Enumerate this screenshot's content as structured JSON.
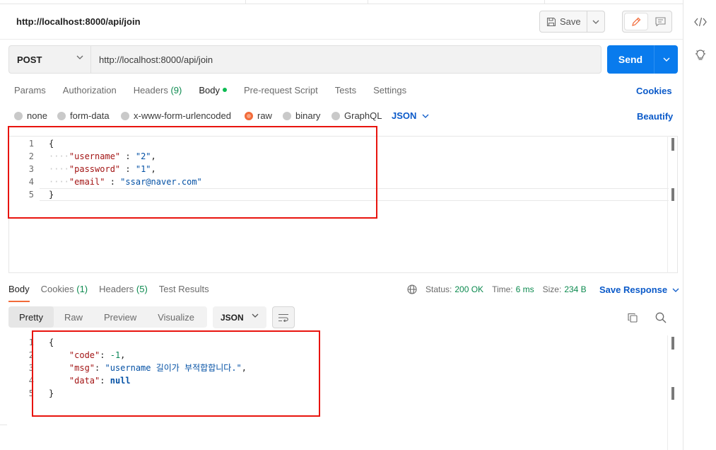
{
  "request": {
    "title": "http://localhost:8000/api/join",
    "save_label": "Save",
    "method": "POST",
    "url": "http://localhost:8000/api/join",
    "send_label": "Send",
    "tabs": [
      {
        "label": "Params"
      },
      {
        "label": "Authorization"
      },
      {
        "label": "Headers",
        "count": "(9)"
      },
      {
        "label": "Body"
      },
      {
        "label": "Pre-request Script"
      },
      {
        "label": "Tests"
      },
      {
        "label": "Settings"
      }
    ],
    "cookies_label": "Cookies",
    "body_types": [
      "none",
      "form-data",
      "x-www-form-urlencoded",
      "raw",
      "binary",
      "GraphQL"
    ],
    "selected_body_type": "raw",
    "format": "JSON",
    "beautify_label": "Beautify",
    "line_numbers": [
      "1",
      "2",
      "3",
      "4",
      "5"
    ],
    "body_lines": {
      "open": "{",
      "l2_key": "\"username\"",
      "l2_sep": " : ",
      "l2_val": "\"2\"",
      "l3_key": "\"password\"",
      "l3_sep": " : ",
      "l3_val": "\"1\"",
      "l4_key": "\"email\"",
      "l4_sep": " : ",
      "l4_val": "\"ssar@naver.com\"",
      "close": "}"
    }
  },
  "response": {
    "tabs": [
      {
        "label": "Body"
      },
      {
        "label": "Cookies",
        "count": "(1)"
      },
      {
        "label": "Headers",
        "count": "(5)"
      },
      {
        "label": "Test Results"
      }
    ],
    "status_label": "Status:",
    "status_value": "200 OK",
    "time_label": "Time:",
    "time_value": "6 ms",
    "size_label": "Size:",
    "size_value": "234 B",
    "save_response_label": "Save Response",
    "view_tabs": [
      "Pretty",
      "Raw",
      "Preview",
      "Visualize"
    ],
    "format": "JSON",
    "line_numbers": [
      "1",
      "2",
      "3",
      "4",
      "5"
    ],
    "body_lines": {
      "open": "{",
      "l2_key": "\"code\"",
      "l2_val": "-1",
      "l3_key": "\"msg\"",
      "l3_val": "\"username 길이가 부적합합니다.\"",
      "l4_key": "\"data\"",
      "l4_val": "null",
      "close": "}"
    }
  },
  "icons": {
    "rail_top": "code-icon",
    "rail_second": "lightbulb-icon",
    "save": "save-icon",
    "edit": "pencil-icon",
    "comment": "comment-icon",
    "globe": "globe-icon",
    "wrap": "wrap-lines-icon",
    "copy": "copy-icon",
    "search": "search-icon"
  },
  "colors": {
    "accent": "#097bed",
    "active_tab": "#f26b3a",
    "highlight_box": "#e8140e",
    "status_ok": "#0c8a4f",
    "link": "#0b5ac9"
  }
}
